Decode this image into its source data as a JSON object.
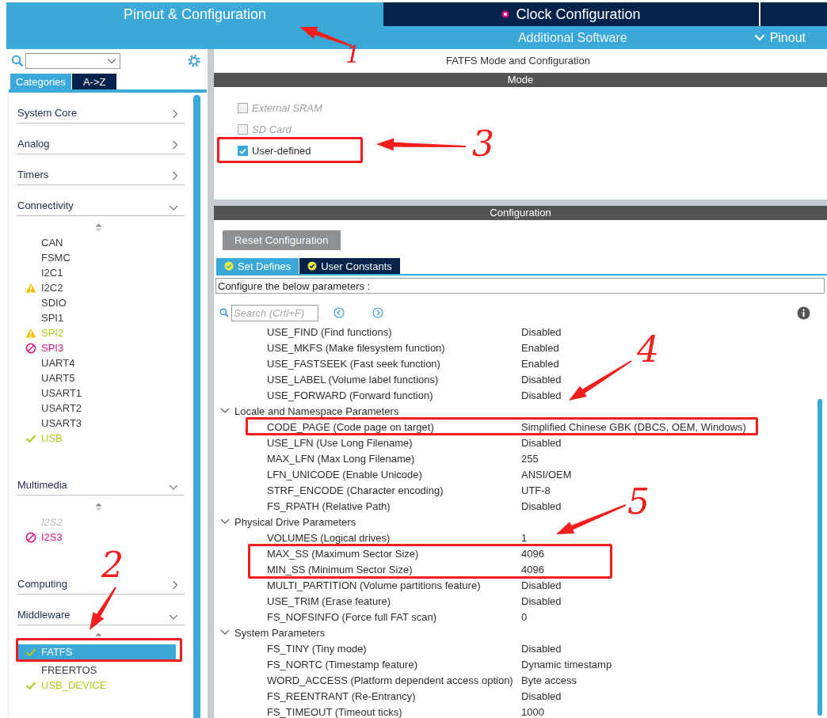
{
  "header": {
    "tabs": [
      {
        "label": "Pinout & Configuration",
        "selected": true,
        "kind": "plain"
      },
      {
        "label": "Clock Configuration",
        "selected": false,
        "kind": "error"
      }
    ],
    "subnav": [
      {
        "label": "Additional Software",
        "kind": "link"
      },
      {
        "label": "Pinout",
        "kind": "dropdown"
      }
    ]
  },
  "sidebar": {
    "view_tabs": [
      {
        "label": "Categories",
        "selected": true
      },
      {
        "label": "A->Z",
        "selected": false
      }
    ],
    "categories": [
      {
        "label": "System Core",
        "expanded": false
      },
      {
        "label": "Analog",
        "expanded": false
      },
      {
        "label": "Timers",
        "expanded": false
      },
      {
        "label": "Connectivity",
        "expanded": true,
        "items": [
          {
            "label": "CAN",
            "kind": "plain",
            "selected": false
          },
          {
            "label": "FSMC",
            "kind": "plain",
            "selected": false
          },
          {
            "label": "I2C1",
            "kind": "plain",
            "selected": false
          },
          {
            "label": "I2C2",
            "kind": "warning",
            "selected": false
          },
          {
            "label": "SDIO",
            "kind": "plain",
            "selected": false
          },
          {
            "label": "SPI1",
            "kind": "plain",
            "selected": false
          },
          {
            "label": "SPI2",
            "kind": "partial",
            "selected": false
          },
          {
            "label": "SPI3",
            "kind": "error",
            "selected": false
          },
          {
            "label": "UART4",
            "kind": "plain",
            "selected": false
          },
          {
            "label": "UART5",
            "kind": "plain",
            "selected": false
          },
          {
            "label": "USART1",
            "kind": "plain",
            "selected": false
          },
          {
            "label": "USART2",
            "kind": "plain",
            "selected": false
          },
          {
            "label": "USART3",
            "kind": "plain",
            "selected": false
          },
          {
            "label": "USB",
            "kind": "ok",
            "selected": false
          }
        ]
      },
      {
        "label": "Multimedia",
        "expanded": true,
        "items": [
          {
            "label": "I2S2",
            "kind": "disabled",
            "selected": false
          },
          {
            "label": "I2S3",
            "kind": "error",
            "selected": false
          }
        ]
      },
      {
        "label": "Computing",
        "expanded": false
      },
      {
        "label": "Middleware",
        "expanded": true,
        "items": [
          {
            "label": "FATFS",
            "kind": "ok",
            "selected": true
          },
          {
            "label": "FREERTOS",
            "kind": "plain",
            "selected": false
          },
          {
            "label": "USB_DEVICE",
            "kind": "ok",
            "selected": false
          }
        ]
      }
    ]
  },
  "main": {
    "title": "FATFS Mode and Configuration",
    "mode_header": "Mode",
    "modes": [
      {
        "label": "External SRAM",
        "checked": false,
        "disabled": true
      },
      {
        "label": "SD Card",
        "checked": false,
        "disabled": true
      },
      {
        "label": "User-defined",
        "checked": true,
        "disabled": false
      }
    ],
    "config_header": "Configuration",
    "reset_button": "Reset Configuration",
    "config_tabs": [
      {
        "label": "Set Defines",
        "selected": true
      },
      {
        "label": "User Constants",
        "selected": false
      }
    ],
    "hint": "Configure the below parameters :",
    "search": {
      "placeholder": "Search (Crtl+F)"
    },
    "params": [
      {
        "kind": "param",
        "name": "USE_FIND (Find functions)",
        "value": "Disabled"
      },
      {
        "kind": "param",
        "name": "USE_MKFS (Make filesystem function)",
        "value": "Enabled"
      },
      {
        "kind": "param",
        "name": "USE_FASTSEEK (Fast seek function)",
        "value": "Enabled"
      },
      {
        "kind": "param",
        "name": "USE_LABEL (Volume label functions)",
        "value": "Disabled"
      },
      {
        "kind": "param",
        "name": "USE_FORWARD (Forward function)",
        "value": "Disabled"
      },
      {
        "kind": "group",
        "name": "Locale and Namespace Parameters",
        "expanded": true,
        "children": [
          {
            "kind": "param",
            "name": "CODE_PAGE (Code page on target)",
            "value": "Simplified Chinese GBK (DBCS, OEM, Windows)"
          },
          {
            "kind": "param",
            "name": "USE_LFN (Use Long Filename)",
            "value": "Disabled"
          },
          {
            "kind": "param",
            "name": "MAX_LFN (Max Long Filename)",
            "value": "255"
          },
          {
            "kind": "param",
            "name": "LFN_UNICODE (Enable Unicode)",
            "value": "ANSI/OEM"
          },
          {
            "kind": "param",
            "name": "STRF_ENCODE (Character encoding)",
            "value": "UTF-8"
          },
          {
            "kind": "param",
            "name": "FS_RPATH (Relative Path)",
            "value": "Disabled"
          }
        ]
      },
      {
        "kind": "group",
        "name": "Physical Drive Parameters",
        "expanded": true,
        "children": [
          {
            "kind": "param",
            "name": "VOLUMES (Logical drives)",
            "value": "1"
          },
          {
            "kind": "param",
            "name": "MAX_SS (Maximum Sector Size)",
            "value": "4096"
          },
          {
            "kind": "param",
            "name": "MIN_SS (Minimum Sector Size)",
            "value": "4096"
          },
          {
            "kind": "param",
            "name": "MULTI_PARTITION (Volume partitions feature)",
            "value": "Disabled"
          },
          {
            "kind": "param",
            "name": "USE_TRIM (Erase feature)",
            "value": "Disabled"
          },
          {
            "kind": "param",
            "name": "FS_NOFSINFO (Force full FAT scan)",
            "value": "0"
          }
        ]
      },
      {
        "kind": "group",
        "name": "System Parameters",
        "expanded": true,
        "children": [
          {
            "kind": "param",
            "name": "FS_TINY (Tiny mode)",
            "value": "Disabled"
          },
          {
            "kind": "param",
            "name": "FS_NORTC (Timestamp feature)",
            "value": "Dynamic timestamp"
          },
          {
            "kind": "param",
            "name": "WORD_ACCESS (Platform dependent access option)",
            "value": "Byte access"
          },
          {
            "kind": "param",
            "name": "FS_REENTRANT (Re-Entrancy)",
            "value": "Disabled"
          },
          {
            "kind": "param",
            "name": "FS_TIMEOUT (Timeout ticks)",
            "value": "1000"
          }
        ]
      }
    ]
  },
  "annotations": [
    {
      "label": "1",
      "kind": "arrow"
    },
    {
      "label": "2",
      "kind": "boxed"
    },
    {
      "label": "3",
      "kind": "boxed"
    },
    {
      "label": "4",
      "kind": "boxed"
    },
    {
      "label": "5",
      "kind": "boxed"
    }
  ]
}
